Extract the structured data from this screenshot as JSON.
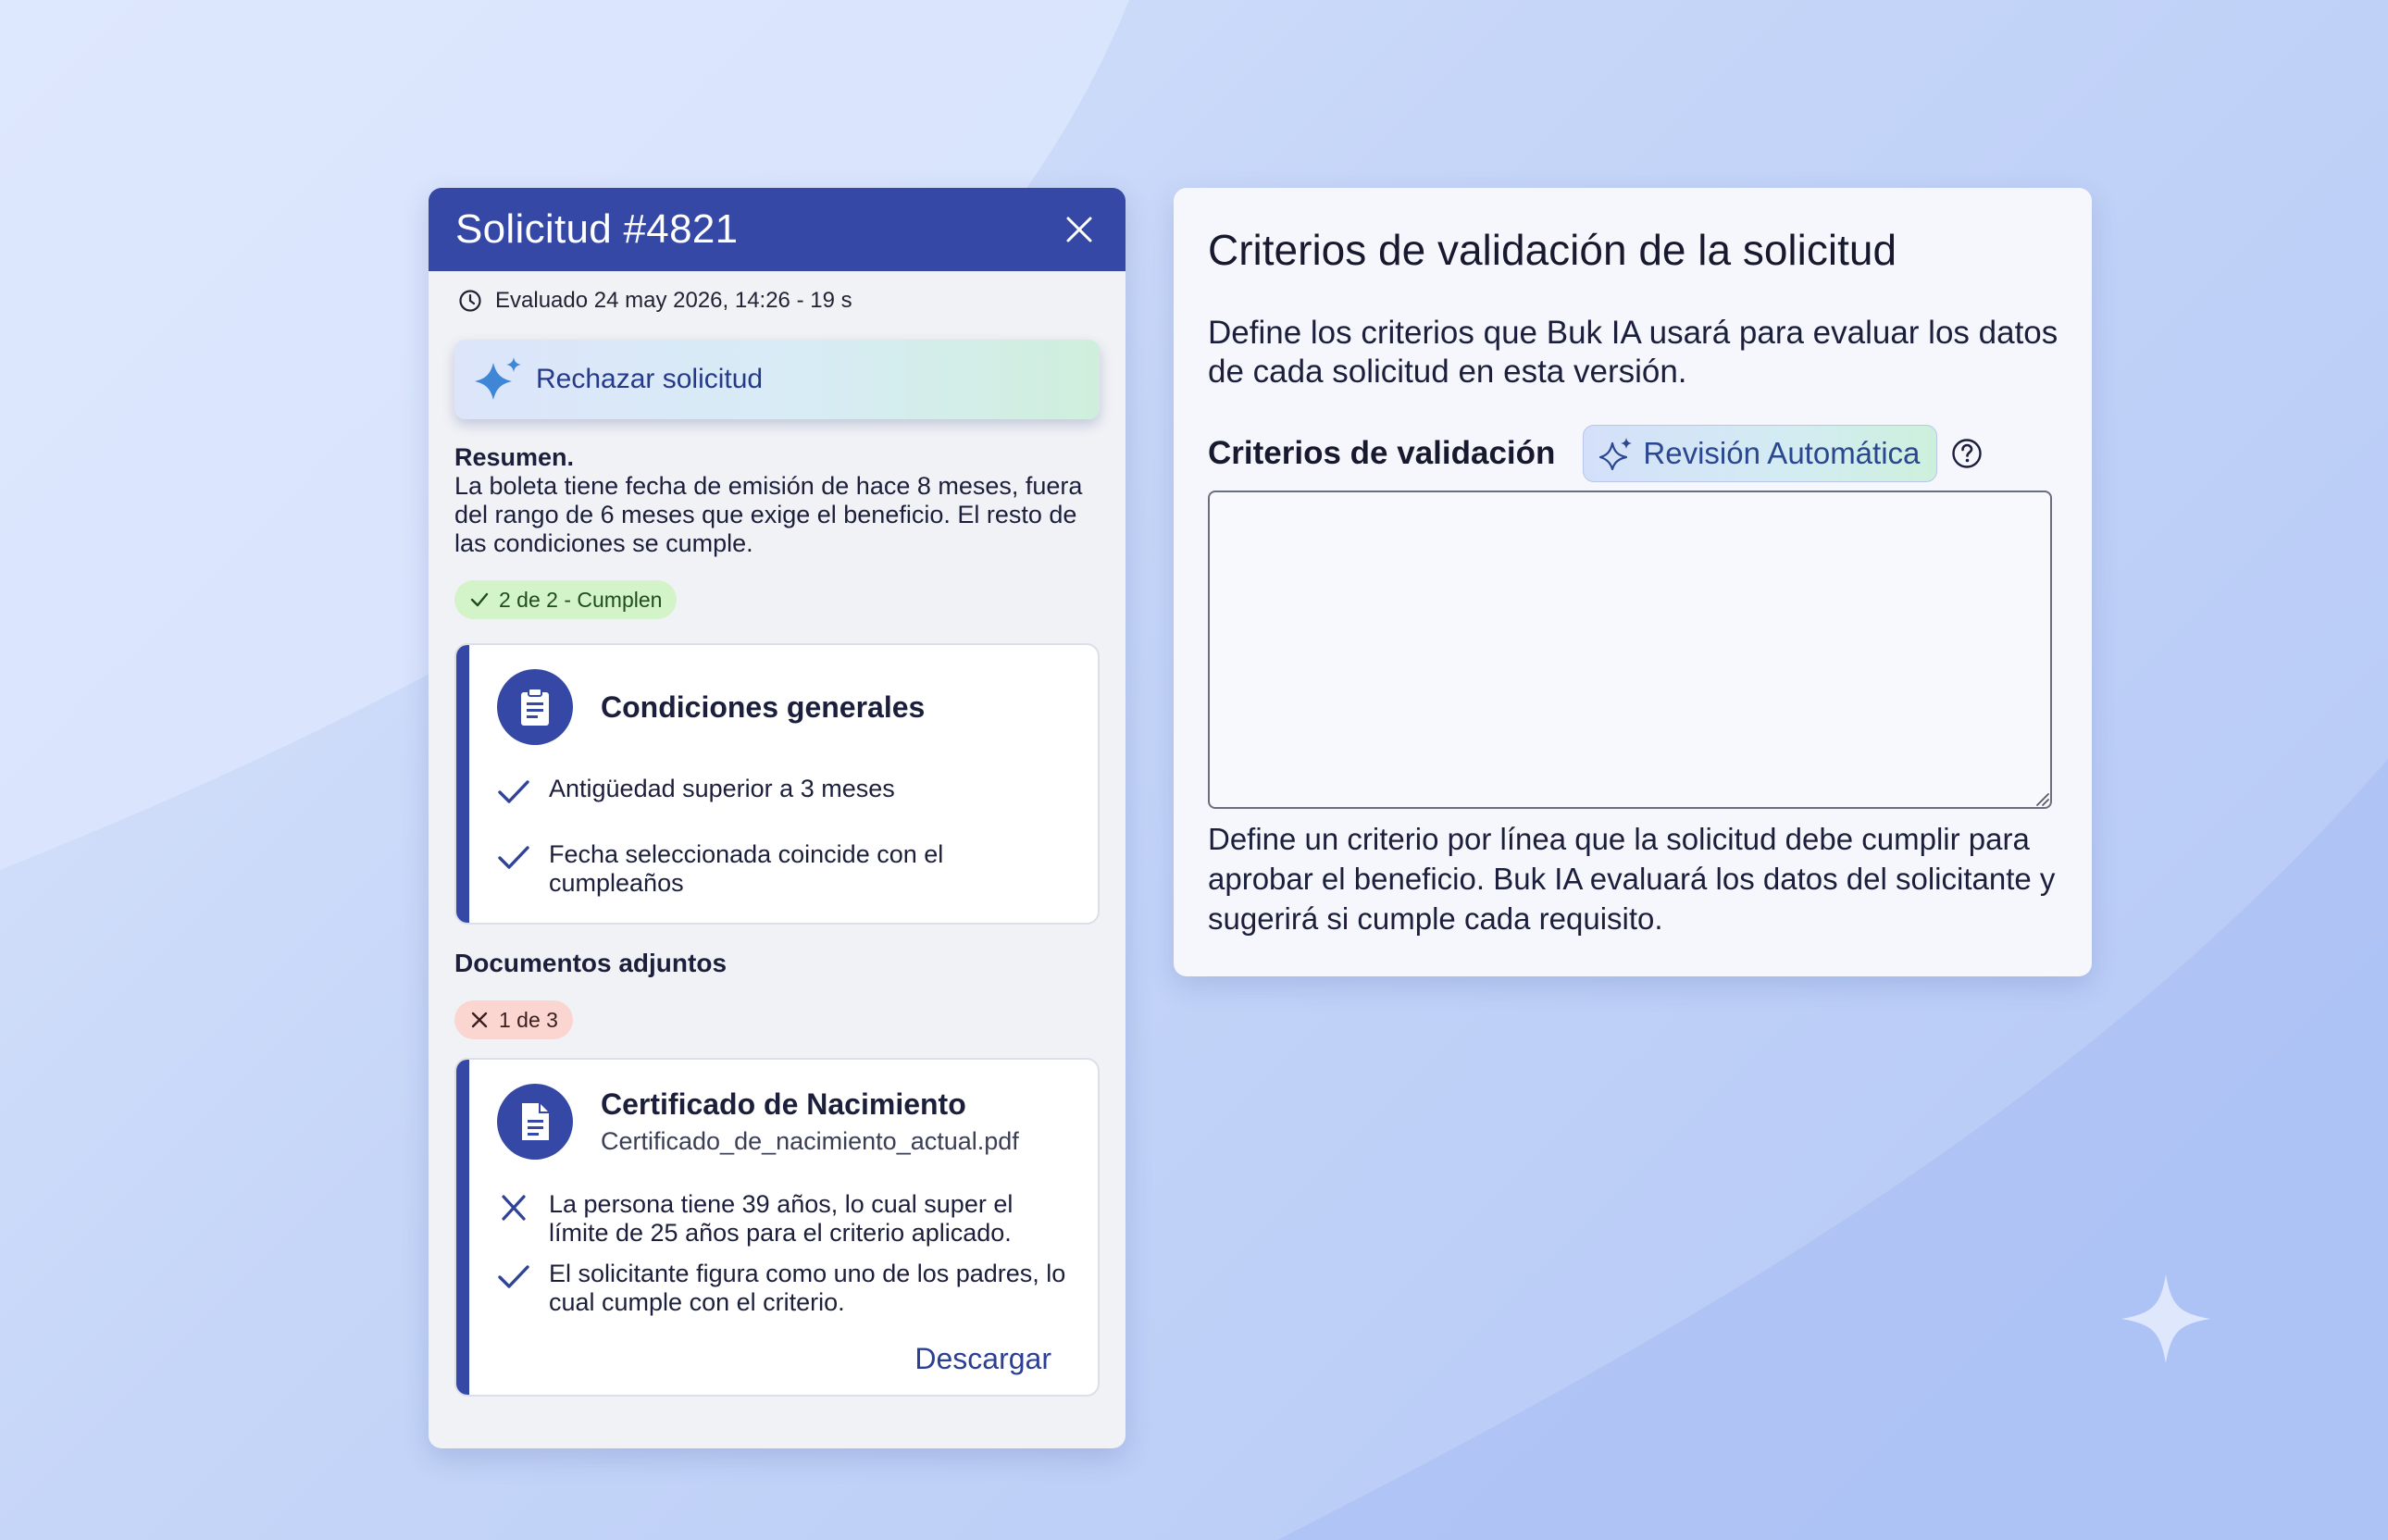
{
  "request_panel": {
    "title": "Solicitud #4821",
    "close_icon": "close-icon",
    "evaluated": "Evaluado 24 may 2026, 14:26 - 19 s",
    "recommendation": "Rechazar solicitud",
    "summary_title": "Resumen.",
    "summary_text": "La boleta tiene fecha de emisión de hace 8 meses, fuera del rango de 6 meses que exige el beneficio. El resto de las condiciones se cumple.",
    "conditions_badge": "2 de 2 - Cumplen",
    "conditions": {
      "title": "Condiciones generales",
      "icon": "clipboard-icon",
      "items": [
        {
          "status": "ok",
          "text": "Antigüedad superior a 3 meses"
        },
        {
          "status": "ok",
          "text": "Fecha seleccionada coincide con el cumpleaños"
        }
      ]
    },
    "documents_title": "Documentos adjuntos",
    "documents_badge": "1 de 3",
    "document": {
      "title": "Certificado de Nacimiento",
      "filename": "Certificado_de_nacimiento_actual.pdf",
      "icon": "document-icon",
      "items": [
        {
          "status": "fail",
          "text": "La persona tiene 39 años, lo cual super el límite de 25 años para el criterio aplicado."
        },
        {
          "status": "ok",
          "text": "El solicitante figura como uno de los padres, lo cual cumple con el criterio."
        }
      ],
      "download_label": "Descargar"
    }
  },
  "criteria_panel": {
    "title": "Criterios de validación de la solicitud",
    "description": "Define los criterios que Buk IA usará para evaluar los datos de cada solicitud en esta versión.",
    "field_label": "Criterios de validación",
    "auto_badge": "Revisión Automática",
    "input_value": "",
    "help_text": "Define un criterio por línea que la solicitud debe cumplir para aprobar el beneficio. Buk IA evaluará los datos del solicitante y sugerirá si cumple cada requisito."
  },
  "colors": {
    "primary": "#3548a6",
    "success_bg": "#d3f3c8",
    "error_bg": "#fbd5cf",
    "sparkle": "#3f86d6"
  }
}
